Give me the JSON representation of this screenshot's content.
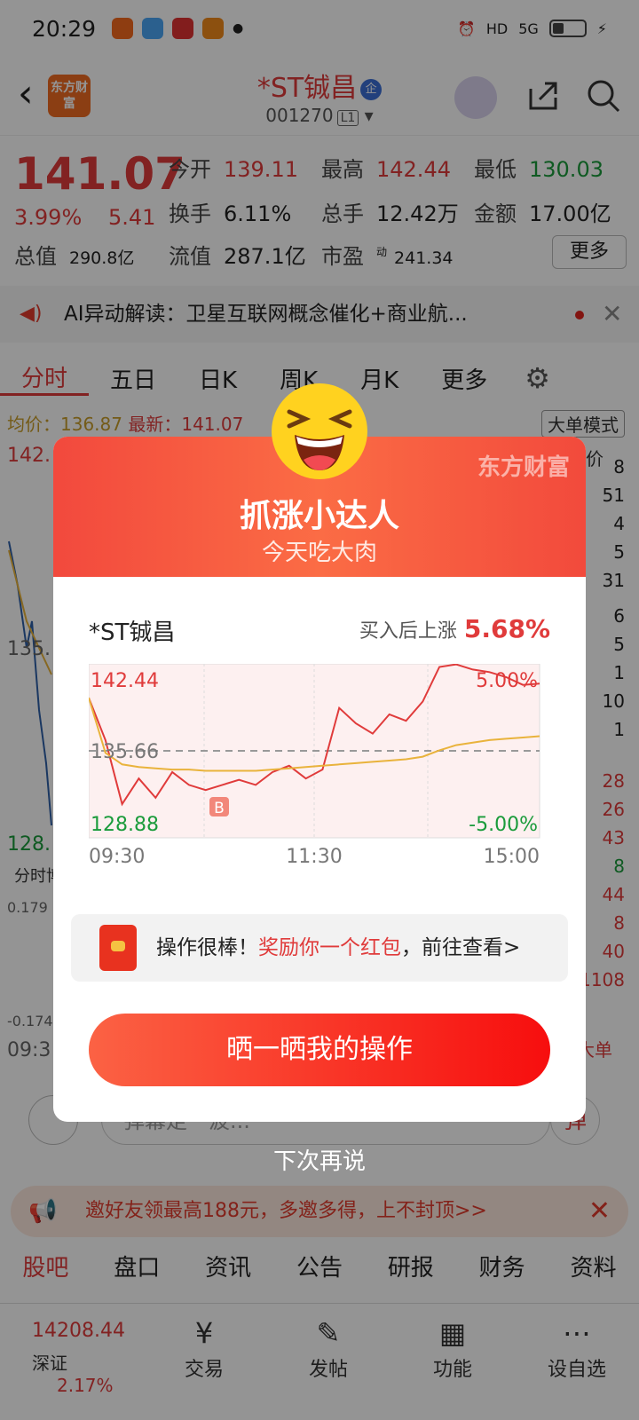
{
  "status": {
    "time": "20:29",
    "hd": "HD",
    "net": "5G"
  },
  "header": {
    "logo_text": "东方财富",
    "title": "*ST铖昌",
    "badge": "企",
    "code": "001270",
    "level": "L1"
  },
  "quote": {
    "price": "141.07",
    "change_pct": "3.99%",
    "change": "5.41",
    "open_k": "今开",
    "open_v": "139.11",
    "high_k": "最高",
    "high_v": "142.44",
    "low_k": "最低",
    "low_v": "130.03",
    "turn_k": "换手",
    "turn_v": "6.11%",
    "vol_k": "总手",
    "vol_v": "12.42万",
    "amt_k": "金额",
    "amt_v": "17.00亿",
    "cap_k": "总值",
    "cap_v": "290.8亿",
    "float_k": "流值",
    "float_v": "287.1亿",
    "pe_k": "市盈",
    "pe_sup": "动",
    "pe_v": "241.34",
    "more": "更多"
  },
  "ai": {
    "text": "AI异动解读：卫星互联网概念催化+商业航..."
  },
  "tabs": [
    "分时",
    "五日",
    "日K",
    "周K",
    "月K",
    "更多"
  ],
  "subrow": {
    "avg": "均价：136.87",
    "latest": "最新：141.07",
    "big_mode": "大单模式",
    "price_col": "分价"
  },
  "bg_chart": {
    "top": "142.",
    "mid": "135.",
    "low": "128.",
    "panel": "分时博",
    "v1": "0.179",
    "v2": "-0.174",
    "t": "09:3",
    "dan": "大单"
  },
  "side_numbers": [
    "8",
    "51",
    "4",
    "5",
    "31",
    "6",
    "5",
    "1",
    "10",
    "1",
    "28",
    "26",
    "43",
    "8",
    "44",
    "8",
    "40",
    "1108"
  ],
  "danmu": {
    "placeholder": "弹幕走一波...",
    "dan": "弹"
  },
  "invite": {
    "text": "邀好友领最高188元，多邀多得，上不封顶>>"
  },
  "bar2": [
    "股吧",
    "盘口",
    "资讯",
    "公告",
    "研报",
    "财务",
    "资料"
  ],
  "nav": {
    "index_value": "14208.44",
    "index_name": "深证",
    "index_pct": "2.17%",
    "items": [
      {
        "label": "交易",
        "icon": "yen-icon"
      },
      {
        "label": "发帖",
        "icon": "edit-icon"
      },
      {
        "label": "功能",
        "icon": "grid-icon"
      },
      {
        "label": "设自选",
        "icon": "more-icon"
      }
    ]
  },
  "modal": {
    "watermark": "东方财富",
    "title": "抓涨小达人",
    "subtitle": "今天吃大肉",
    "stock": "*ST铖昌",
    "gain_label": "买入后上涨",
    "gain_value": "5.68%",
    "tip_prefix": "操作很棒！",
    "tip_highlight": "奖励你一个红包",
    "tip_suffix": "，前往查看>",
    "cta": "晒一晒我的操作",
    "skip": "下次再说"
  },
  "chart_data": {
    "type": "line",
    "y_top_label": "142.44",
    "y_mid_label": "135.66",
    "y_bottom_label": "128.88",
    "pct_top_label": "5.00%",
    "pct_bottom_label": "-5.00%",
    "x_labels": [
      "09:30",
      "11:30",
      "15:00"
    ],
    "buy_marker": "B",
    "ylim": [
      128.88,
      142.44
    ],
    "series": [
      {
        "values": [
          139.8,
          136.5,
          131.5,
          133.5,
          132.0,
          134.0,
          133.0,
          132.6,
          133.0,
          133.4,
          133.0,
          134.0,
          134.5,
          133.5,
          134.2,
          139.0,
          137.8,
          137.0,
          138.5,
          138.0,
          139.5,
          142.2,
          142.4,
          142.0,
          141.8,
          141.4,
          140.8,
          140.9
        ]
      },
      {
        "values": [
          139.8,
          135.5,
          134.6,
          134.4,
          134.3,
          134.2,
          134.2,
          134.1,
          134.1,
          134.1,
          134.1,
          134.2,
          134.3,
          134.4,
          134.5,
          134.6,
          134.7,
          134.8,
          134.9,
          135.0,
          135.2,
          135.7,
          136.1,
          136.3,
          136.5,
          136.6,
          136.7,
          136.8
        ]
      }
    ]
  },
  "colors": {
    "red": "#e03b3b",
    "green": "#1a9b3b",
    "avg_line": "#e9b33c"
  }
}
